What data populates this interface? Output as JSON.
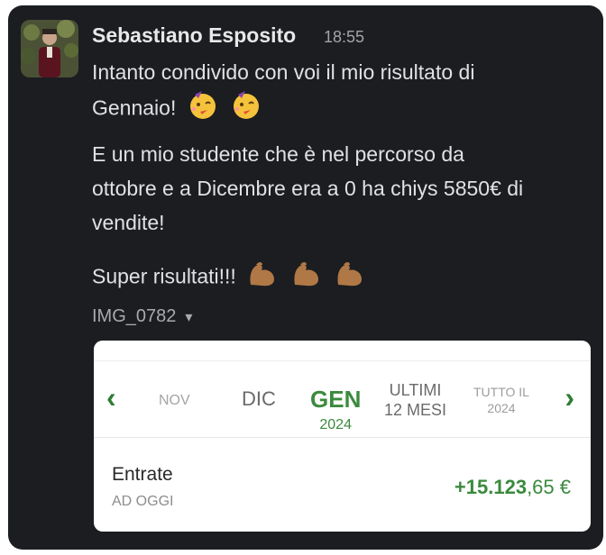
{
  "message": {
    "author": "Sebastiano Esposito",
    "time": "18:55",
    "paragraphs": [
      [
        "Intanto condivido con voi il mio risultato di",
        "Gennaio!"
      ],
      [
        "E un mio studente che è nel percorso da",
        "ottobre e a Dicembre era a 0 ha chiys 5850€ di",
        "vendite!"
      ],
      [
        "Super risultati!!!"
      ]
    ],
    "emoji": {
      "celebration": [
        "partying-face",
        "partying-face"
      ],
      "strength": [
        "flexed-biceps",
        "flexed-biceps",
        "flexed-biceps"
      ]
    },
    "attachment": {
      "name": "IMG_0782",
      "toggle": "▾"
    }
  },
  "card": {
    "nav_prev": "‹",
    "nav_next": "›",
    "tabs": {
      "nov": "NOV",
      "dic": "DIC",
      "gen": "GEN",
      "gen_year": "2024",
      "ultimi_1": "ULTIMI",
      "ultimi_2": "12 MESI",
      "tutto_1": "TUTTO IL",
      "tutto_2": "2024"
    },
    "income_label": "Entrate",
    "income_sub": "AD OGGI",
    "amount_int": "+15.123",
    "amount_dec": ",65 €"
  },
  "colors": {
    "accent_green": "#3b8a3e",
    "background": "#1b1d21"
  }
}
